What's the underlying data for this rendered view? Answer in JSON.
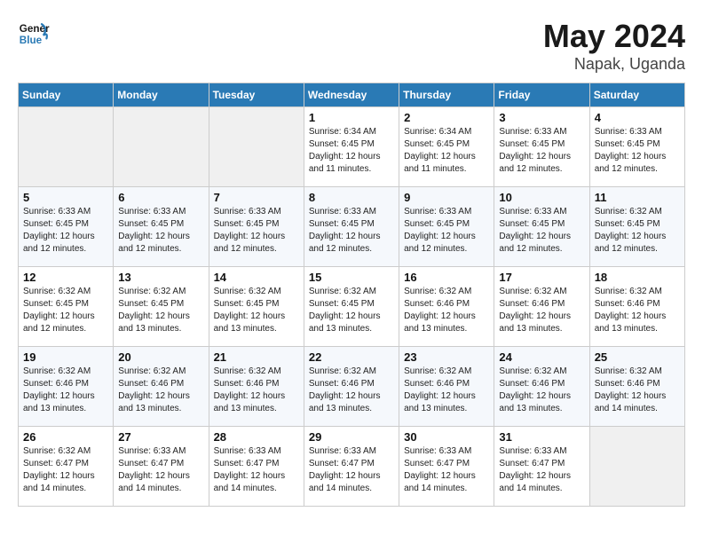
{
  "header": {
    "logo_line1": "General",
    "logo_line2": "Blue",
    "month": "May 2024",
    "location": "Napak, Uganda"
  },
  "weekdays": [
    "Sunday",
    "Monday",
    "Tuesday",
    "Wednesday",
    "Thursday",
    "Friday",
    "Saturday"
  ],
  "weeks": [
    [
      {
        "day": "",
        "info": ""
      },
      {
        "day": "",
        "info": ""
      },
      {
        "day": "",
        "info": ""
      },
      {
        "day": "1",
        "info": "Sunrise: 6:34 AM\nSunset: 6:45 PM\nDaylight: 12 hours\nand 11 minutes."
      },
      {
        "day": "2",
        "info": "Sunrise: 6:34 AM\nSunset: 6:45 PM\nDaylight: 12 hours\nand 11 minutes."
      },
      {
        "day": "3",
        "info": "Sunrise: 6:33 AM\nSunset: 6:45 PM\nDaylight: 12 hours\nand 12 minutes."
      },
      {
        "day": "4",
        "info": "Sunrise: 6:33 AM\nSunset: 6:45 PM\nDaylight: 12 hours\nand 12 minutes."
      }
    ],
    [
      {
        "day": "5",
        "info": "Sunrise: 6:33 AM\nSunset: 6:45 PM\nDaylight: 12 hours\nand 12 minutes."
      },
      {
        "day": "6",
        "info": "Sunrise: 6:33 AM\nSunset: 6:45 PM\nDaylight: 12 hours\nand 12 minutes."
      },
      {
        "day": "7",
        "info": "Sunrise: 6:33 AM\nSunset: 6:45 PM\nDaylight: 12 hours\nand 12 minutes."
      },
      {
        "day": "8",
        "info": "Sunrise: 6:33 AM\nSunset: 6:45 PM\nDaylight: 12 hours\nand 12 minutes."
      },
      {
        "day": "9",
        "info": "Sunrise: 6:33 AM\nSunset: 6:45 PM\nDaylight: 12 hours\nand 12 minutes."
      },
      {
        "day": "10",
        "info": "Sunrise: 6:33 AM\nSunset: 6:45 PM\nDaylight: 12 hours\nand 12 minutes."
      },
      {
        "day": "11",
        "info": "Sunrise: 6:32 AM\nSunset: 6:45 PM\nDaylight: 12 hours\nand 12 minutes."
      }
    ],
    [
      {
        "day": "12",
        "info": "Sunrise: 6:32 AM\nSunset: 6:45 PM\nDaylight: 12 hours\nand 12 minutes."
      },
      {
        "day": "13",
        "info": "Sunrise: 6:32 AM\nSunset: 6:45 PM\nDaylight: 12 hours\nand 13 minutes."
      },
      {
        "day": "14",
        "info": "Sunrise: 6:32 AM\nSunset: 6:45 PM\nDaylight: 12 hours\nand 13 minutes."
      },
      {
        "day": "15",
        "info": "Sunrise: 6:32 AM\nSunset: 6:45 PM\nDaylight: 12 hours\nand 13 minutes."
      },
      {
        "day": "16",
        "info": "Sunrise: 6:32 AM\nSunset: 6:46 PM\nDaylight: 12 hours\nand 13 minutes."
      },
      {
        "day": "17",
        "info": "Sunrise: 6:32 AM\nSunset: 6:46 PM\nDaylight: 12 hours\nand 13 minutes."
      },
      {
        "day": "18",
        "info": "Sunrise: 6:32 AM\nSunset: 6:46 PM\nDaylight: 12 hours\nand 13 minutes."
      }
    ],
    [
      {
        "day": "19",
        "info": "Sunrise: 6:32 AM\nSunset: 6:46 PM\nDaylight: 12 hours\nand 13 minutes."
      },
      {
        "day": "20",
        "info": "Sunrise: 6:32 AM\nSunset: 6:46 PM\nDaylight: 12 hours\nand 13 minutes."
      },
      {
        "day": "21",
        "info": "Sunrise: 6:32 AM\nSunset: 6:46 PM\nDaylight: 12 hours\nand 13 minutes."
      },
      {
        "day": "22",
        "info": "Sunrise: 6:32 AM\nSunset: 6:46 PM\nDaylight: 12 hours\nand 13 minutes."
      },
      {
        "day": "23",
        "info": "Sunrise: 6:32 AM\nSunset: 6:46 PM\nDaylight: 12 hours\nand 13 minutes."
      },
      {
        "day": "24",
        "info": "Sunrise: 6:32 AM\nSunset: 6:46 PM\nDaylight: 12 hours\nand 13 minutes."
      },
      {
        "day": "25",
        "info": "Sunrise: 6:32 AM\nSunset: 6:46 PM\nDaylight: 12 hours\nand 14 minutes."
      }
    ],
    [
      {
        "day": "26",
        "info": "Sunrise: 6:32 AM\nSunset: 6:47 PM\nDaylight: 12 hours\nand 14 minutes."
      },
      {
        "day": "27",
        "info": "Sunrise: 6:33 AM\nSunset: 6:47 PM\nDaylight: 12 hours\nand 14 minutes."
      },
      {
        "day": "28",
        "info": "Sunrise: 6:33 AM\nSunset: 6:47 PM\nDaylight: 12 hours\nand 14 minutes."
      },
      {
        "day": "29",
        "info": "Sunrise: 6:33 AM\nSunset: 6:47 PM\nDaylight: 12 hours\nand 14 minutes."
      },
      {
        "day": "30",
        "info": "Sunrise: 6:33 AM\nSunset: 6:47 PM\nDaylight: 12 hours\nand 14 minutes."
      },
      {
        "day": "31",
        "info": "Sunrise: 6:33 AM\nSunset: 6:47 PM\nDaylight: 12 hours\nand 14 minutes."
      },
      {
        "day": "",
        "info": ""
      }
    ]
  ]
}
